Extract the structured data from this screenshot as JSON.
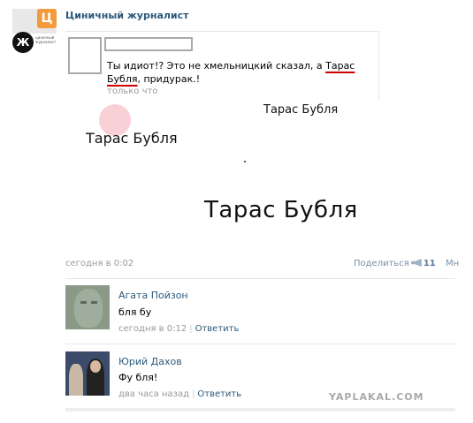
{
  "group": {
    "name": "Циничный журналист",
    "logo_letter": "Ц",
    "logo_letter2": "Ж",
    "logo_text": "циничный журналист"
  },
  "repost": {
    "text_before": "Ты идиот!? Это не хмельницкий сказал, а ",
    "text_highlight": "Тарас Бубля",
    "text_after": ", придурак.!",
    "time": "только что"
  },
  "overlay_words": {
    "small": "Тарас Бубля",
    "medium": "Тарас Бубля",
    "large": "Тарас Бубля"
  },
  "post": {
    "time": "сегодня в 0:02",
    "share_label": "Поделиться",
    "share_count": "11",
    "more_label": "Мн"
  },
  "comments": [
    {
      "author": "Агата Пойзон",
      "text": "бля бу",
      "time": "сегодня в 0:12",
      "reply": "Ответить"
    },
    {
      "author": "Юрий Дахов",
      "text": "Фу бля!",
      "time": "два часа назад",
      "reply": "Ответить"
    }
  ],
  "watermark": "YAPLAKAL.COM",
  "colors": {
    "link": "#2b587a",
    "meta": "#999999",
    "underline": "#cc0000",
    "logo": "#f39a3c"
  }
}
